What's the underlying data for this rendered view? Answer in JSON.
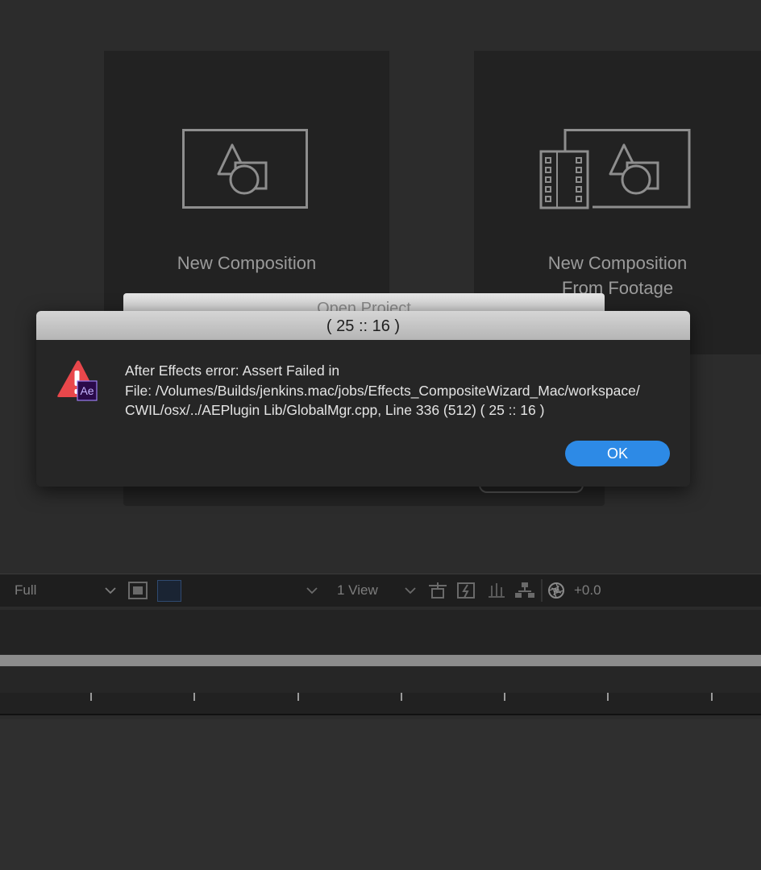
{
  "home": {
    "new_composition_label": "New Composition",
    "new_from_footage_line1": "New Composition",
    "new_from_footage_line2": "From Footage",
    "open_project_label": "Open Project"
  },
  "error_dialog": {
    "title": "( 25 :: 16 )",
    "app_badge": "Ae",
    "message_line1": "After Effects error: Assert Failed in",
    "message_line2": "File: /Volumes/Builds/jenkins.mac/jobs/Effects_CompositeWizard_Mac/workspace/",
    "message_line3": "CWIL/osx/../AEPlugin Lib/GlobalMgr.cpp, Line 336  (512) ( 25 :: 16 )",
    "ok_label": "OK"
  },
  "viewer_toolbar": {
    "resolution": "Full",
    "view_layout": "1 View",
    "exposure": "+0.0"
  },
  "colors": {
    "accent": "#2d8ae6",
    "warning_red": "#e8474b",
    "ae_badge": "#2a0a4a"
  }
}
